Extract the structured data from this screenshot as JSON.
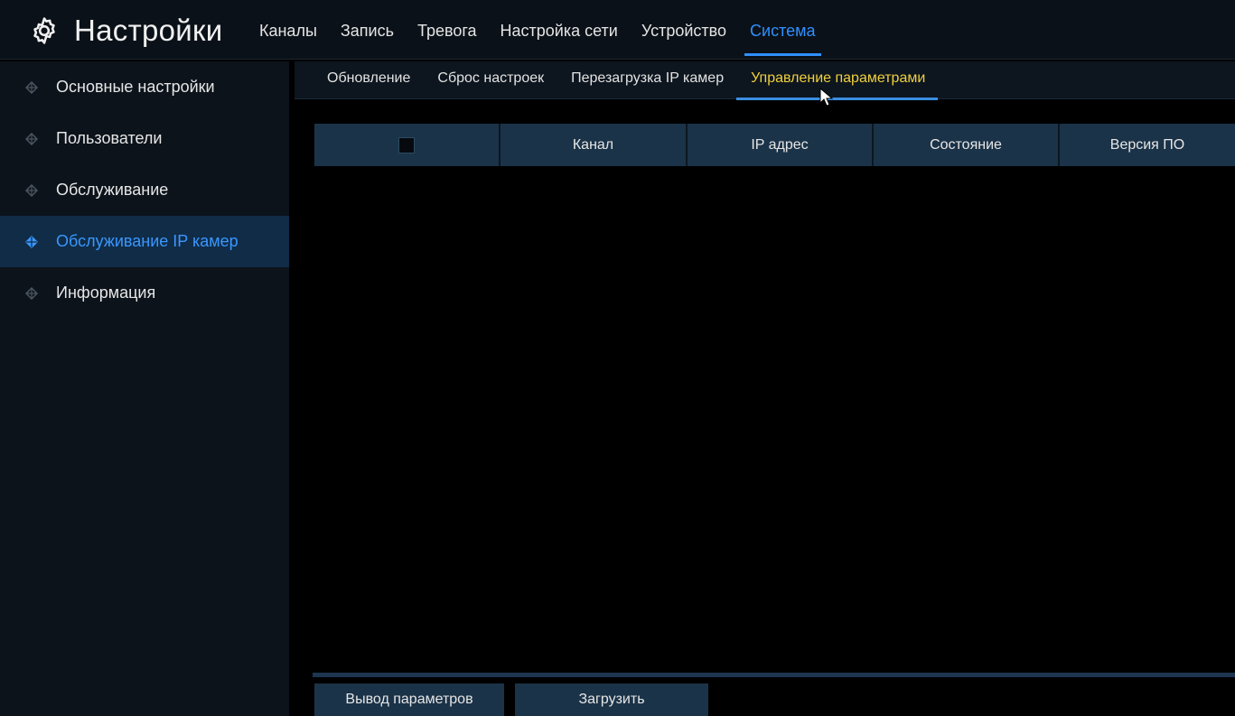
{
  "header": {
    "title": "Настройки",
    "tabs": [
      "Каналы",
      "Запись",
      "Тревога",
      "Настройка сети",
      "Устройство",
      "Система"
    ],
    "active_tab_index": 5
  },
  "sidebar": {
    "items": [
      {
        "label": "Основные настройки"
      },
      {
        "label": "Пользователи"
      },
      {
        "label": "Обслуживание"
      },
      {
        "label": "Обслуживание IP камер"
      },
      {
        "label": "Информация"
      }
    ],
    "active_index": 3
  },
  "subtabs": {
    "items": [
      "Обновление",
      "Сброс настроек",
      "Перезагрузка IP камер",
      "Управление параметрами"
    ],
    "active_index": 3
  },
  "table": {
    "columns": [
      "Канал",
      "IP адрес",
      "Состояние",
      "Версия ПО"
    ],
    "select_all_checked": false,
    "rows": []
  },
  "buttons": {
    "export_label": "Вывод параметров",
    "load_label": "Загрузить"
  },
  "colors": {
    "accent": "#2f8fff",
    "active_subtab": "#f0d03c",
    "header_cell": "#1b3348",
    "sidebar_active": "#102c47"
  }
}
